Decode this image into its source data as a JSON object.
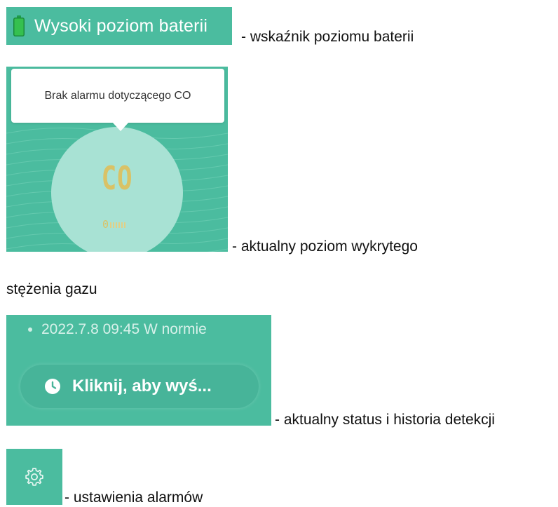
{
  "battery": {
    "label": "Wysoki poziom baterii",
    "caption": "- wskaźnik poziomu baterii",
    "icon": "battery-full-icon",
    "icon_color": "#35c04f"
  },
  "gauge": {
    "tooltip": "Brak alarmu dotyczącego CO",
    "gas_label": "CO",
    "reading": "0",
    "caption_line1": "- aktualny poziom wykrytego",
    "caption_line2": "stężenia gazu"
  },
  "status": {
    "last_entry": "2022.7.8 09:45 W normie",
    "history_button": "Kliknij, aby wyś...",
    "history_icon": "clock-icon",
    "caption": "- aktualny status i historia detekcji"
  },
  "settings": {
    "icon": "gear-icon",
    "caption": "- ustawienia alarmów"
  },
  "colors": {
    "panel_teal": "#4bbc9f",
    "gauge_circle": "#a8e2d4",
    "gauge_text": "#d9c266"
  }
}
